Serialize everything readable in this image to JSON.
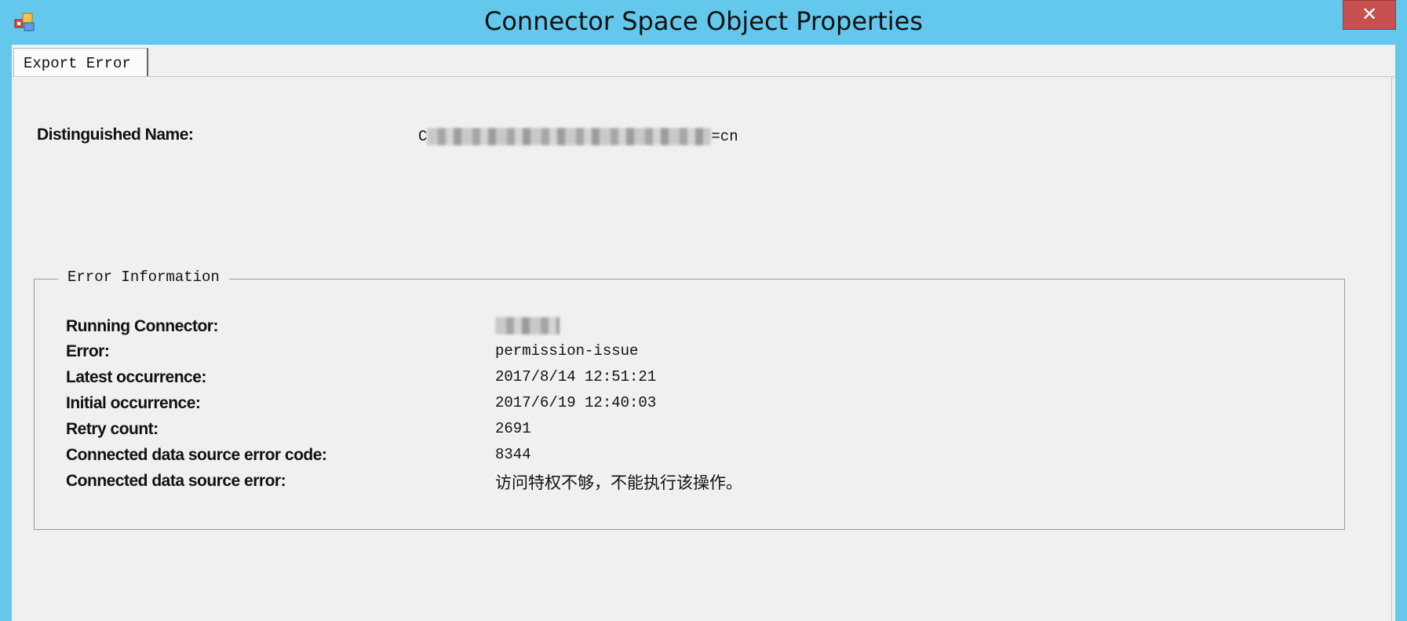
{
  "window": {
    "title": "Connector Space Object Properties",
    "close_glyph": "✕",
    "app_icon": "connector-app-icon",
    "accent_color": "#64c8ec",
    "close_color": "#c75050"
  },
  "tabs": [
    {
      "label": "Export Error",
      "selected": true
    }
  ],
  "distinguished_name": {
    "label": "Distinguished Name:",
    "value_prefix": "C",
    "value_suffix": "=cn"
  },
  "error_info": {
    "legend": "Error Information",
    "rows": [
      {
        "label": "Running Connector:",
        "value": ""
      },
      {
        "label": "Error:",
        "value": "permission-issue"
      },
      {
        "label": "Latest occurrence:",
        "value": "2017/8/14 12:51:21"
      },
      {
        "label": "Initial occurrence:",
        "value": "2017/6/19 12:40:03"
      },
      {
        "label": "Retry count:",
        "value": "2691"
      },
      {
        "label": "Connected data source error code:",
        "value": "8344"
      },
      {
        "label": "Connected data source error:",
        "value": "访问特权不够，不能执行该操作。"
      }
    ]
  }
}
